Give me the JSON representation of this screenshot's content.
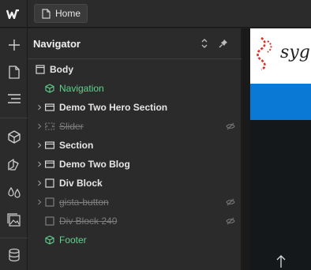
{
  "top_bar": {
    "home_tab_label": "Home"
  },
  "navigator": {
    "title": "Navigator",
    "nodes": [
      {
        "label": "Body",
        "icon": "box-outline-icon",
        "state": "normal"
      },
      {
        "label": "Navigation",
        "icon": "component-icon",
        "state": "component"
      },
      {
        "label": "Demo Two Hero Section",
        "icon": "section-icon",
        "state": "normal"
      },
      {
        "label": "Slider",
        "icon": "slider-icon",
        "state": "hidden"
      },
      {
        "label": "Section",
        "icon": "section-icon",
        "state": "normal"
      },
      {
        "label": "Demo Two Blog",
        "icon": "section-icon",
        "state": "normal"
      },
      {
        "label": "Div Block",
        "icon": "box-outline-icon",
        "state": "normal"
      },
      {
        "label": "gista-button",
        "icon": "box-outline-icon",
        "state": "hidden"
      },
      {
        "label": "Div Block 240",
        "icon": "box-outline-icon",
        "state": "hidden"
      },
      {
        "label": "Footer",
        "icon": "component-icon",
        "state": "component"
      }
    ]
  },
  "canvas": {
    "brand_text": "sygn"
  },
  "colors": {
    "accent_green": "#5fd38d",
    "nav_blue": "#0a79d6",
    "panel_bg": "#2b2b2b"
  }
}
